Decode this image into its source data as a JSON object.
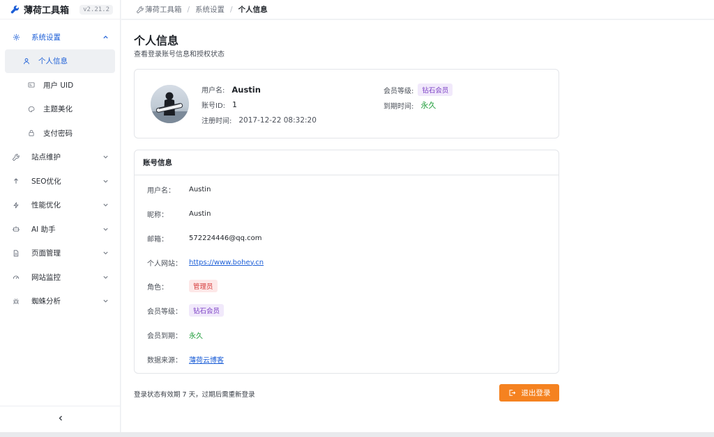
{
  "app": {
    "title": "薄荷工具箱",
    "version": "v2.21.2"
  },
  "sidebar": {
    "groups": [
      {
        "label": "系统设置",
        "icon": "gear-icon",
        "open": true
      },
      {
        "label": "站点维护",
        "icon": "wrench-icon"
      },
      {
        "label": "SEO优化",
        "icon": "arrow-up-icon"
      },
      {
        "label": "性能优化",
        "icon": "lightning-icon"
      },
      {
        "label": "AI 助手",
        "icon": "robot-icon"
      },
      {
        "label": "页面管理",
        "icon": "document-icon"
      },
      {
        "label": "网站监控",
        "icon": "gauge-icon"
      },
      {
        "label": "蜘蛛分析",
        "icon": "spider-icon"
      }
    ],
    "sub_items": [
      {
        "label": "个人信息",
        "icon": "user-icon",
        "active": true
      },
      {
        "label": "用户 UID",
        "icon": "id-card-icon"
      },
      {
        "label": "主题美化",
        "icon": "palette-icon"
      },
      {
        "label": "支付密码",
        "icon": "lock-icon"
      }
    ]
  },
  "breadcrumb": {
    "root": "薄荷工具箱",
    "mid": "系统设置",
    "current": "个人信息"
  },
  "page": {
    "title": "个人信息",
    "subtitle": "查看登录账号信息和授权状态"
  },
  "profile": {
    "username_label": "用户名:",
    "username": "Austin",
    "id_label": "账号ID:",
    "id": "1",
    "reg_label": "注册时间:",
    "reg_time": "2017-12-22 08:32:20",
    "level_label": "会员等级:",
    "level": "钻石会员",
    "expire_label": "到期时间:",
    "expire": "永久"
  },
  "account": {
    "header": "账号信息",
    "rows": [
      {
        "label": "用户名：",
        "value": "Austin"
      },
      {
        "label": "昵称：",
        "value": "Austin"
      },
      {
        "label": "邮箱：",
        "value": "572224446@qq.com"
      },
      {
        "label": "个人网站：",
        "value": "https://www.bohey.cn"
      },
      {
        "label": "角色：",
        "value": "管理员"
      },
      {
        "label": "会员等级：",
        "value": "钻石会员"
      },
      {
        "label": "会员到期：",
        "value": "永久"
      },
      {
        "label": "数据来源：",
        "value": "薄荷云博客"
      }
    ]
  },
  "footer": {
    "note": "登录状态有效期 7 天，过期后需重新登录",
    "logout_label": "退出登录"
  },
  "colors": {
    "accent": "#1d5fd7",
    "logout": "#f58220",
    "purple_tag": "#7b3fc4",
    "red_tag": "#d53a3a",
    "green": "#1f9d3a"
  }
}
